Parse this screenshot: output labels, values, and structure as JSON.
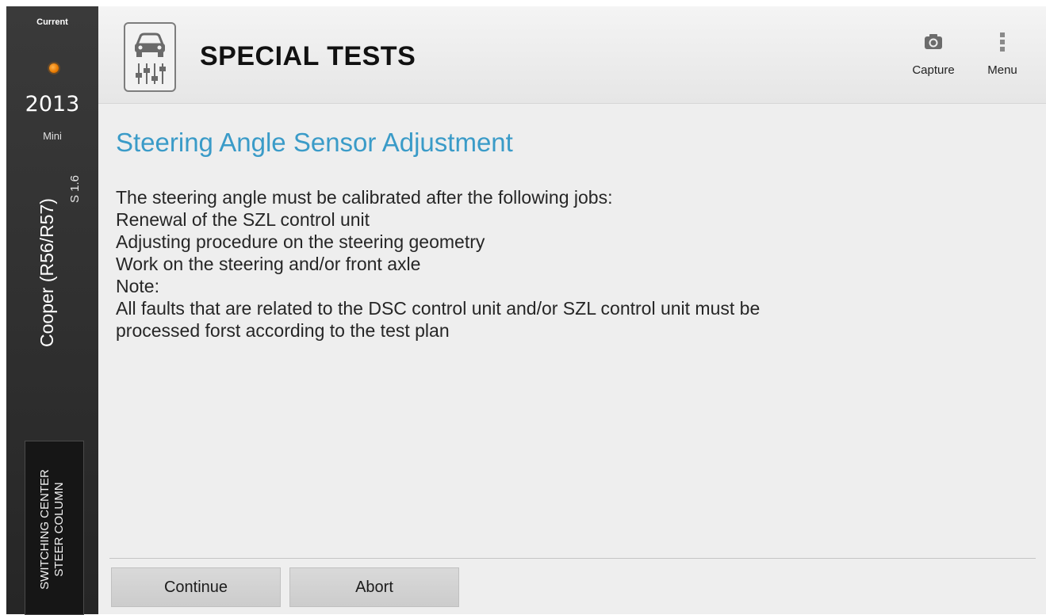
{
  "sidebar": {
    "current_label": "Current",
    "year": "2013",
    "make": "Mini",
    "model": "Cooper (R56/R57)",
    "engine": "S 1.6",
    "module_lines": [
      "SWITCHING CENTER",
      "STEER COLUMN"
    ],
    "status_dot_color": "#e87a00"
  },
  "header": {
    "title": "SPECIAL TESTS",
    "icon": "car-adjustment-icon",
    "capture_label": "Capture",
    "capture_icon": "camera-icon",
    "menu_label": "Menu",
    "menu_icon": "overflow-menu-icon"
  },
  "main": {
    "title": "Steering Angle Sensor Adjustment",
    "title_color": "#3a9bc8",
    "lines": [
      "The steering angle must be calibrated after the following jobs:",
      "Renewal of the SZL control unit",
      "Adjusting procedure on the steering geometry",
      "Work on the steering and/or front axle",
      "Note:",
      "All faults that are related to the DSC control unit and/or SZL control unit must be",
      "processed forst according to the test plan"
    ]
  },
  "buttons": {
    "continue_label": "Continue",
    "abort_label": "Abort"
  }
}
